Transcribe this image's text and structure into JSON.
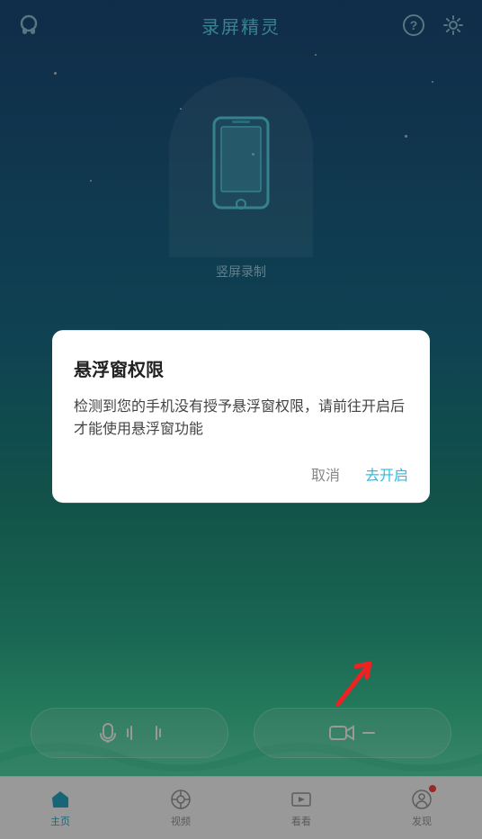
{
  "header": {
    "title": "录屏精灵",
    "help_icon": "?",
    "settings_icon": "⚙"
  },
  "phone_label": "竖屏录制",
  "dialog": {
    "title": "悬浮窗权限",
    "body": "检测到您的手机没有授予悬浮窗权限，请前往开启后才能使用悬浮窗功能",
    "cancel_label": "取消",
    "confirm_label": "去开启"
  },
  "bottom_nav": [
    {
      "label": "主页",
      "active": true
    },
    {
      "label": "视频",
      "active": false
    },
    {
      "label": "看看",
      "active": false
    },
    {
      "label": "发现",
      "active": false,
      "badge": true
    }
  ]
}
